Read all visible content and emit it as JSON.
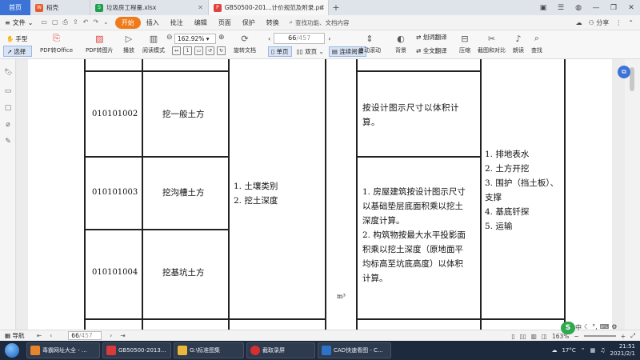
{
  "tabs": {
    "home": "首页",
    "items": [
      {
        "label": "稻壳",
        "icon_color": "#e85a2c",
        "active": false,
        "closable": false
      },
      {
        "label": "垃圾房工程量.xlsx",
        "icon_color": "#1e9e4a",
        "active": false,
        "closable": true
      },
      {
        "label": "GB50500-201...计价规范及附录.pdf",
        "icon_color": "#e04040",
        "active": true,
        "closable": true
      }
    ],
    "plus": "+"
  },
  "menu": {
    "file": "文件",
    "items": [
      "开始",
      "插入",
      "批注",
      "编辑",
      "页面",
      "保护",
      "转换"
    ],
    "active": "开始",
    "search": "查找功能、文档内容",
    "share": "分享"
  },
  "toolbar": {
    "hand": "手型",
    "select": "选择",
    "pdf_to_office": "PDF转Office",
    "pdf_to_image": "PDF转图片",
    "play": "播放",
    "read_mode": "阅读模式",
    "zoom": "162.92%",
    "rotate": "旋转文档",
    "page_current": "66",
    "page_total": "/457",
    "single": "单页",
    "double": "双页",
    "continuous": "连续阅读",
    "auto_scroll": "自动滚动",
    "background": "背景",
    "translate": "划词翻译",
    "full_translate": "全文翻译",
    "compress": "压缩",
    "screenshot": "截图和对比",
    "read_aloud": "朗读",
    "find": "查找"
  },
  "table": {
    "rows": [
      {
        "code": "010101002",
        "name": "挖一般土方",
        "rule": [
          "按设计图示尺寸以体积计",
          "算。"
        ]
      },
      {
        "code": "010101003",
        "name": "挖沟槽土方"
      },
      {
        "code": "010101004",
        "name": "挖基坑土方"
      }
    ],
    "features": [
      "1. 土壤类别",
      "2. 挖土深度"
    ],
    "unit": "m³",
    "rule_shared": [
      "1. 房屋建筑按设计图示尺寸",
      "以基础垫层底面积乘以挖土",
      "深度计算。",
      "2. 构筑物按最大水平投影面",
      "积乘以挖土深度（原地面平",
      "均标高至坑底高度）以体积",
      "计算。"
    ],
    "work": [
      "1. 排地表水",
      "2. 土方开挖",
      "3. 围护（挡土板）、",
      "支撑",
      "4. 基底钎探",
      "5. 运输"
    ]
  },
  "statusbar": {
    "nav": "导航",
    "page_current": "66",
    "page_total": "/457",
    "zoom": "163%"
  },
  "taskbar": {
    "items": [
      {
        "label": "毒霸网址大全 - ...",
        "color": "#e8852c"
      },
      {
        "label": "GB50500-2013...",
        "color": "#d73b3b"
      },
      {
        "label": "G:\\标准图集",
        "color": "#e9b73b"
      },
      {
        "label": "截取录屏",
        "color": "#d43030"
      },
      {
        "label": "CAD快速看图 - C...",
        "color": "#2c74c9"
      }
    ],
    "weather": "17°C",
    "time": "21:51",
    "date": "2021/2/1"
  }
}
